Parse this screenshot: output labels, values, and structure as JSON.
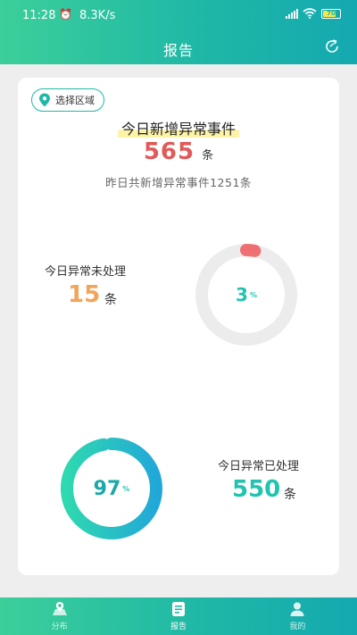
{
  "statusbar": {
    "time": "11:28",
    "speed": "8.3K/s",
    "battery": "70"
  },
  "header": {
    "title": "报告"
  },
  "card": {
    "region_button": "选择区域",
    "headline": "今日新增异常事件",
    "today_count": "565",
    "today_unit": "条",
    "yesterday_text": "昨日共新增异常事件1251条",
    "unprocessed": {
      "label": "今日异常未处理",
      "count": "15",
      "unit": "条",
      "percent": "3",
      "percent_sign": "%",
      "fraction": 0.03
    },
    "processed": {
      "label": "今日异常已处理",
      "count": "550",
      "unit": "条",
      "percent": "97",
      "percent_sign": "%",
      "fraction": 0.97
    }
  },
  "tabs": [
    {
      "label": "分布",
      "icon": "map-pin-icon",
      "active": false
    },
    {
      "label": "报告",
      "icon": "report-icon",
      "active": true
    },
    {
      "label": "我的",
      "icon": "user-icon",
      "active": false
    }
  ],
  "colors": {
    "primary": "#1fb8a6",
    "today_number": "#e05a5a",
    "unprocessed_number": "#f2a45a",
    "processed_number": "#22c4b0"
  }
}
